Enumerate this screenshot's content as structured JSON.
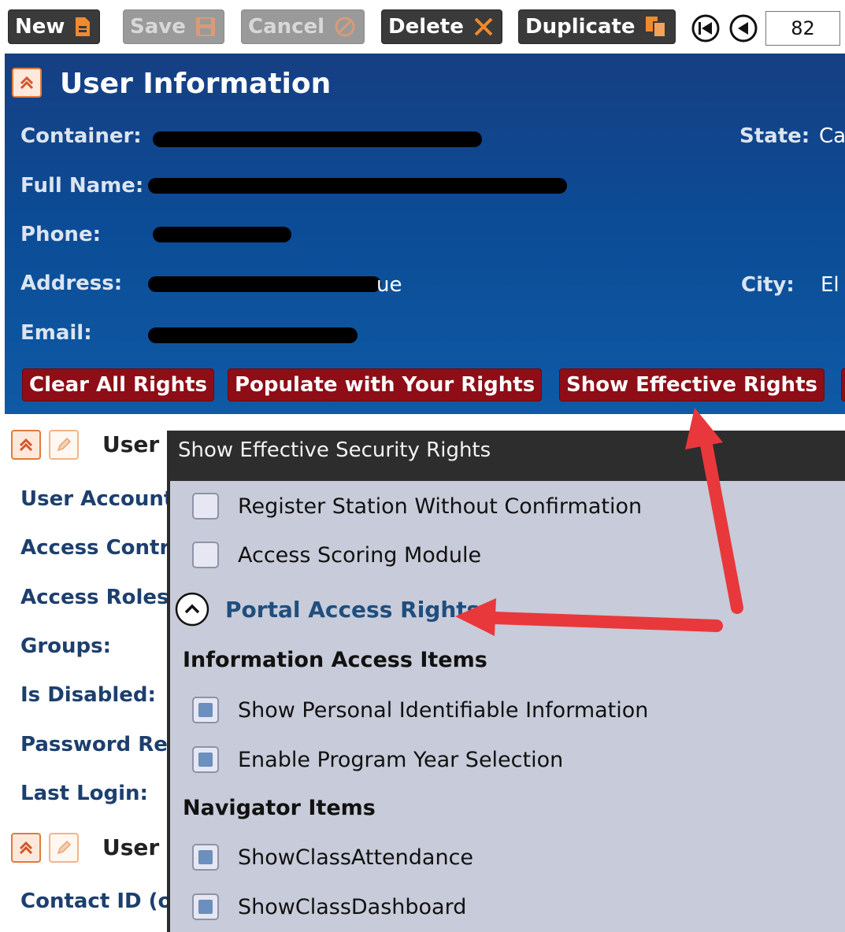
{
  "toolbar": {
    "new_label": "New",
    "save_label": "Save",
    "cancel_label": "Cancel",
    "delete_label": "Delete",
    "duplicate_label": "Duplicate",
    "record_number": "82"
  },
  "user_info": {
    "title": "User Information",
    "container_label": "Container:",
    "state_label": "State:",
    "state_value": "Ca",
    "fullname_label": "Full Name:",
    "phone_label": "Phone:",
    "address_label": "Address:",
    "address_visible_tail": "ue",
    "city_label": "City:",
    "city_value": "El",
    "email_label": "Email:",
    "buttons": {
      "clear_all": "Clear All Rights",
      "populate": "Populate with Your Rights",
      "show_effective": "Show Effective Rights"
    }
  },
  "lower_section": {
    "section1_title": "User",
    "labels": {
      "user_account": "User Account",
      "access_control": "Access Contro",
      "access_roles": "Access Roles:",
      "groups": "Groups:",
      "is_disabled": "Is Disabled:",
      "password_req": "Password Rec",
      "last_login": "Last Login:",
      "contact_id": "Contact ID (o"
    },
    "section2_title": "User"
  },
  "modal": {
    "title": "Show Effective Security Rights",
    "top_items": [
      {
        "label": "Register Station Without Confirmation",
        "checked": false
      },
      {
        "label": "Access Scoring Module",
        "checked": false
      }
    ],
    "group_title": "Portal Access Rights",
    "info_heading": "Information Access Items",
    "info_items": [
      {
        "label": "Show Personal Identifiable Information",
        "checked": true
      },
      {
        "label": "Enable Program Year Selection",
        "checked": true
      }
    ],
    "nav_heading": "Navigator Items",
    "nav_items": [
      {
        "label": "ShowClassAttendance",
        "checked": true
      },
      {
        "label": "ShowClassDashboard",
        "checked": true
      }
    ]
  },
  "colors": {
    "header_blue": "#0c4b95",
    "action_red": "#8e0d17",
    "accent_orange": "#e07b3b",
    "annotation_arrow": "#e8383c"
  }
}
